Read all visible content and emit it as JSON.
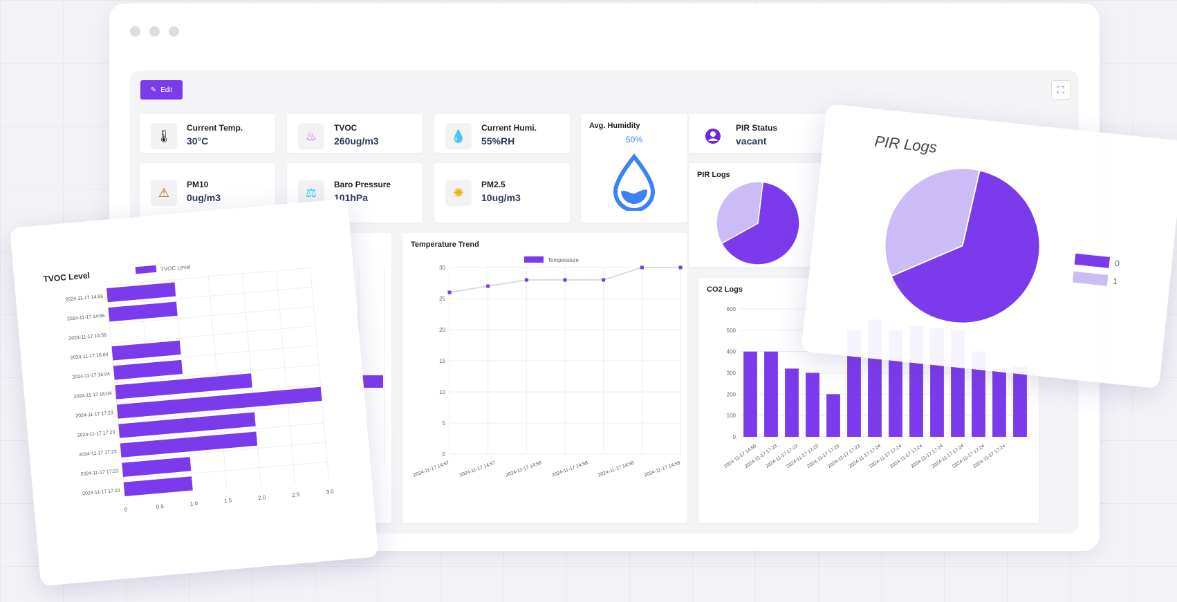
{
  "toolbar": {
    "edit_label": "Edit"
  },
  "stats": [
    {
      "label": "Current Temp.",
      "value": "30°C",
      "icon": "thermometer-icon",
      "icon_glyph": "🌡",
      "color": "#6b7280"
    },
    {
      "label": "TVOC",
      "value": "260ug/m3",
      "icon": "tvoc-icon",
      "icon_glyph": "♨",
      "color": "#d946ef"
    },
    {
      "label": "Current Humi.",
      "value": "55%RH",
      "icon": "droplet-icon",
      "icon_glyph": "💧",
      "color": "#3b82f6"
    },
    {
      "label": "PM10",
      "value": "0ug/m3",
      "icon": "pm10-icon",
      "icon_glyph": "⚠",
      "color": "#b45309"
    },
    {
      "label": "Baro Pressure",
      "value": "101hPa",
      "icon": "pressure-icon",
      "icon_glyph": "⚖",
      "color": "#22d3ee"
    },
    {
      "label": "PM2.5",
      "value": "10ug/m3",
      "icon": "pm25-icon",
      "icon_glyph": "✺",
      "color": "#facc15"
    }
  ],
  "humidity": {
    "title": "Avg. Humidity",
    "value": "50%",
    "color": "#3b82f6"
  },
  "pir_status": {
    "label": "PIR Status",
    "value": "vacant",
    "icon": "person-icon"
  },
  "pir_logs_small": {
    "title": "PIR Logs"
  },
  "pir_logs_big": {
    "title": "PIR Logs",
    "legend": [
      "0",
      "1"
    ]
  },
  "temperature_trend": {
    "title": "Temperature Trend"
  },
  "co2_logs": {
    "title": "CO2 Logs"
  },
  "tvoc_level": {
    "title": "TVOC Level"
  },
  "colors": {
    "accent": "#7c3aed",
    "accent_light": "#cbbbf7",
    "line": "#d9d9e0"
  },
  "chart_data": [
    {
      "type": "line",
      "title": "Temperature Trend",
      "series": [
        {
          "name": "Temperature",
          "values": [
            26,
            27,
            28,
            28,
            28,
            30,
            30
          ]
        }
      ],
      "y_ticks": [
        "0",
        "5",
        "10",
        "15",
        "20",
        "25",
        "30"
      ],
      "ylim": [
        0,
        30
      ],
      "x_labels": [
        "2024-11-17 14:57",
        "2024-11-17 14:57",
        "2024-11-17 14:58",
        "2024-11-17 14:58",
        "2024-11-17 14:58",
        "2024-11-17 14:59"
      ]
    },
    {
      "type": "bar",
      "title": "CO2 Logs",
      "values": [
        400,
        400,
        320,
        300,
        200,
        500,
        550,
        500,
        520,
        510,
        500,
        400,
        320,
        330
      ],
      "y_ticks": [
        "0",
        "100",
        "200",
        "300",
        "400",
        "500",
        "600"
      ],
      "ylim": [
        0,
        600
      ],
      "x_labels": [
        "2024-11-17 14:55",
        "2024-11-17 17:23",
        "2024-11-17 17:23",
        "2024-11-17 17:23",
        "2024-11-17 17:23",
        "2024-11-17 17:23",
        "2024-11-17 17:24",
        "2024-11-17 17:24",
        "2024-11-17 17:24",
        "2024-11-17 17:24",
        "2024-11-17 17:24",
        "2024-11-17 17:24",
        "2024-11-17 17:24"
      ]
    },
    {
      "type": "pie",
      "title": "PIR Logs",
      "categories": [
        "0",
        "1"
      ],
      "values": [
        65,
        35
      ]
    },
    {
      "type": "bar",
      "orientation": "horizontal",
      "title": "TVOC Level",
      "series": [
        {
          "name": "TVOC Level"
        }
      ],
      "categories": [
        "2024-11-17 14:56",
        "2024-11-17 14:56",
        "2024-11-17 14:56",
        "2024-11-17 16:04",
        "2024-11-17 16:04",
        "2024-11-17 16:04",
        "2024-11-17 17:23",
        "2024-11-17 17:23",
        "2024-11-17 17:23",
        "2024-11-17 17:23",
        "2024-11-17 17:23"
      ],
      "values": [
        1.0,
        1.0,
        0,
        1.0,
        1.0,
        2.0,
        3.0,
        2.0,
        2.0,
        1.0,
        1.0
      ],
      "x_ticks": [
        "0",
        "0.5",
        "1.0",
        "1.5",
        "2.0",
        "2.5",
        "3.0"
      ],
      "xlim": [
        0,
        3
      ]
    }
  ]
}
